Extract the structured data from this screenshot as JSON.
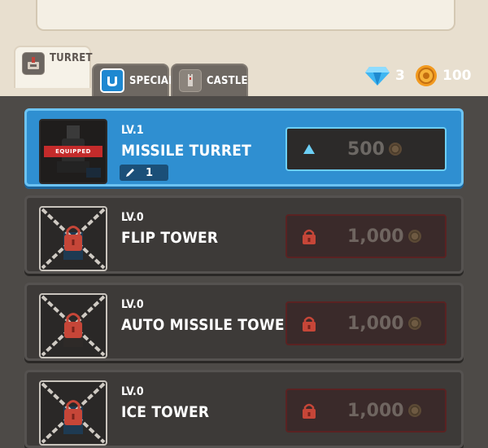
{
  "tabs": [
    {
      "label": "TURRET",
      "active": true
    },
    {
      "label": "SPECIAL",
      "active": false
    },
    {
      "label": "CASTLE",
      "active": false
    }
  ],
  "currency": {
    "gems": "3",
    "coins": "100"
  },
  "colors": {
    "equipped_bg": "#2f8fd1",
    "locked_bg": "#3d3a38",
    "lock_red": "#c64638",
    "gem_blue": "#3fb6f2",
    "coin_orange": "#f29a1f"
  },
  "turrets": [
    {
      "level": "LV.1",
      "name": "MISSILE TURRET",
      "status": "equipped",
      "equipped_label": "EQUIPPED",
      "count": "1",
      "price": "500",
      "price_icon": "up-arrow-icon"
    },
    {
      "level": "LV.0",
      "name": "FLIP TOWER",
      "status": "locked",
      "price": "1,000",
      "price_icon": "lock-icon"
    },
    {
      "level": "LV.0",
      "name": "AUTO MISSILE TOWER",
      "status": "locked",
      "price": "1,000",
      "price_icon": "lock-icon"
    },
    {
      "level": "LV.0",
      "name": "ICE TOWER",
      "status": "locked",
      "price": "1,000",
      "price_icon": "lock-icon"
    }
  ]
}
